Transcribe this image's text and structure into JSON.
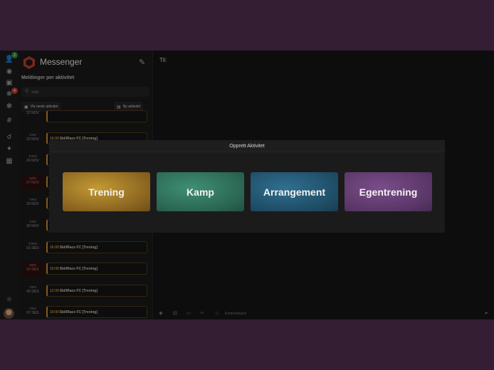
{
  "rail": {
    "icons": [
      "user-icon",
      "chat-icon",
      "calendar-icon",
      "bug-icon",
      "virus-icon",
      "hashtag-icon",
      "search-icon",
      "run-icon",
      "building-icon",
      "lamp-icon"
    ],
    "badges": [
      {
        "count": "2",
        "color": "#2d8a3e"
      },
      {
        "count": "4",
        "color": "#c0392b"
      }
    ]
  },
  "panel": {
    "brand": "Messenger",
    "section_title": "Meldinger per aktivitet",
    "search_placeholder": "Søk",
    "next_activity": "Vis neste aktivitet",
    "new_activity": "Ny aktivitet",
    "days": [
      {
        "dow": "",
        "date": "22 NOV",
        "sunday": false
      },
      {
        "dow": "ONS",
        "date": "23 NOV",
        "sunday": false
      },
      {
        "dow": "TORS",
        "date": "24 NOV",
        "sunday": false
      },
      {
        "dow": "SØN",
        "date": "27 NOV",
        "sunday": true
      },
      {
        "dow": "TIRS",
        "date": "29 NOV",
        "sunday": false
      },
      {
        "dow": "ONS",
        "date": "30 NOV",
        "sunday": false
      },
      {
        "dow": "TORS",
        "date": "01 DES",
        "sunday": false
      },
      {
        "dow": "SØN",
        "date": "04 DES",
        "sunday": true
      },
      {
        "dow": "TIRS",
        "date": "06 DES",
        "sunday": false
      },
      {
        "dow": "ONS",
        "date": "07 DES",
        "sunday": false
      }
    ],
    "events": [
      {
        "time": "",
        "name": ""
      },
      {
        "time": "10:00",
        "name": "SkillRace FC [Trening]"
      },
      {
        "time": "",
        "name": ""
      },
      {
        "time": "",
        "name": ""
      },
      {
        "time": "",
        "name": ""
      },
      {
        "time": "",
        "name": ""
      },
      {
        "time": "16:00",
        "name": "SkillRace FC [Trening]"
      },
      {
        "time": "10:00",
        "name": "SkillRace FC [Trening]"
      },
      {
        "time": "12:00",
        "name": "SkillRace FC [Trening]"
      },
      {
        "time": "10:00",
        "name": "SkillRace FC [Trening]"
      }
    ]
  },
  "chat": {
    "to_label": "Til:",
    "comment_label": "Kommentarer",
    "bottom_icons": [
      "tag-icon",
      "image-icon",
      "trash-icon",
      "scissors-icon",
      "comment-icon"
    ],
    "send_icon": "send-icon"
  },
  "modal": {
    "title": "Opprett Aktivitet",
    "tiles": [
      {
        "key": "trening",
        "label": "Trening"
      },
      {
        "key": "kamp",
        "label": "Kamp"
      },
      {
        "key": "arrangement",
        "label": "Arrangement"
      },
      {
        "key": "egentrening",
        "label": "Egentrening"
      }
    ]
  }
}
